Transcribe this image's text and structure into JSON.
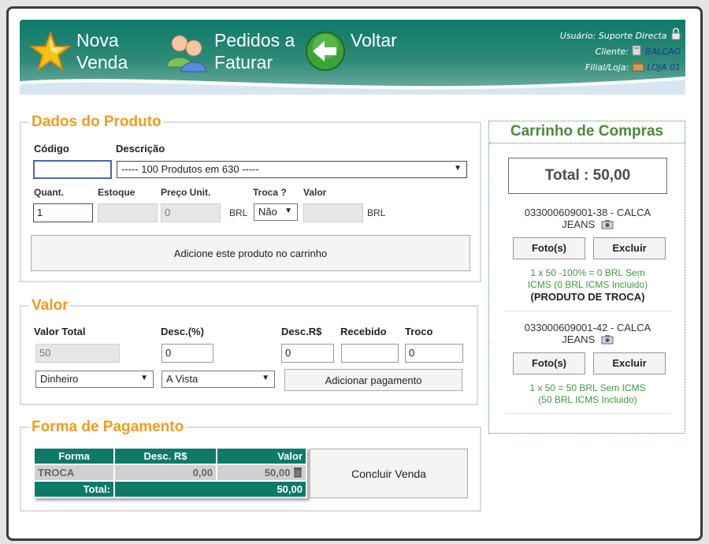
{
  "header": {
    "nova_venda": [
      "Nova",
      "Venda"
    ],
    "pedidos": [
      "Pedidos a",
      "Faturar"
    ],
    "voltar": "Voltar",
    "usuario_label": "Usuário:",
    "usuario_value": "Suporte Directa",
    "cliente_label": "Cliente:",
    "cliente_value": "BALCAO",
    "filial_label": "Filial/Loja:",
    "filial_value": "LOJA 01"
  },
  "produto": {
    "legend": "Dados do Produto",
    "codigo_label": "Código",
    "descricao_label": "Descrição",
    "codigo_value": "",
    "descricao_selected": "----- 100 Produtos em 630 -----",
    "quant_label": "Quant.",
    "estoque_label": "Estoque",
    "preco_label": "Preço Unit.",
    "troca_label": "Troca ?",
    "valor_label": "Valor",
    "quant_value": "1",
    "estoque_value": "",
    "preco_value": "0",
    "preco_unit": "BRL",
    "troca_selected": "Não",
    "valor_value": "",
    "valor_unit": "BRL",
    "add_button": "Adicione este produto no carrinho"
  },
  "valor": {
    "legend": "Valor",
    "valor_total_label": "Valor Total",
    "desc_pct_label": "Desc.(%)",
    "desc_rs_label": "Desc.R$",
    "recebido_label": "Recebido",
    "troco_label": "Troco",
    "valor_total_value": "50",
    "desc_pct_value": "0",
    "desc_rs_value": "0",
    "recebido_value": "",
    "troco_value": "0",
    "forma_selected": "Dinheiro",
    "condicao_selected": "A Vista",
    "add_payment_button": "Adicionar pagamento"
  },
  "pagamento": {
    "legend": "Forma de Pagamento",
    "headers": [
      "Forma",
      "Desc. R$",
      "Valor"
    ],
    "rows": [
      {
        "forma": "TROCA",
        "desc": "0,00",
        "valor": "50,00"
      }
    ],
    "total_label": "Total:",
    "total_value": "50,00",
    "concluir_button": "Concluir Venda"
  },
  "carrinho": {
    "title": "Carrinho de Compras",
    "total_label": "Total :",
    "total_value": "50,00",
    "items": [
      {
        "code": "033000609001-38 - CALCA",
        "name": "JEANS",
        "foto": "Foto(s)",
        "excluir": "Excluir",
        "line1": "1 x 50 -100% = 0 BRL Sem",
        "line2": "ICMS (0 BRL ICMS Incluido)",
        "line3": "(PRODUTO DE TROCA)"
      },
      {
        "code": "033000609001-42 - CALCA",
        "name": "JEANS",
        "foto": "Foto(s)",
        "excluir": "Excluir",
        "line1": "1 x 50 = 50 BRL Sem ICMS",
        "line2": "(50 BRL ICMS Incluido)"
      }
    ]
  }
}
